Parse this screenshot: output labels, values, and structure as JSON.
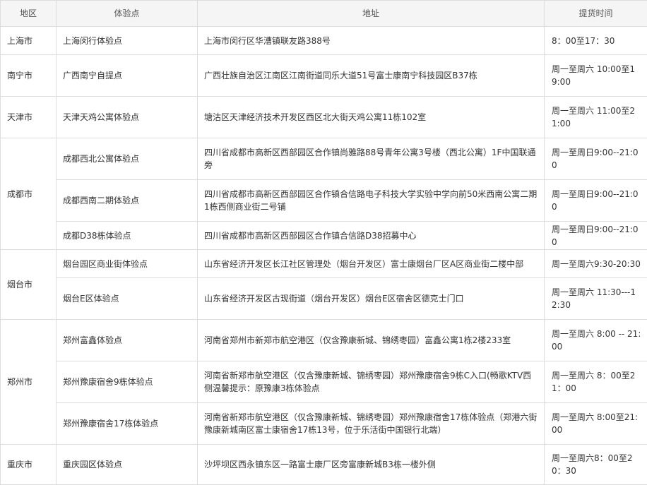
{
  "headers": [
    "地区",
    "体验点",
    "地址",
    "提货时间"
  ],
  "rows": [
    {
      "region": "上海市",
      "site": "上海闵行体验点",
      "address": "上海市闵行区华漕镇联友路388号",
      "hours": "8：00至17：30"
    },
    {
      "region": "南宁市",
      "site": "广西南宁自提点",
      "address": "广西壮族自治区江南区江南街道同乐大道51号富士康南宁科技园区B37栋",
      "hours": "周一至周六 10:00至19:00"
    },
    {
      "region": "天津市",
      "site": "天津天鸡公寓体验点",
      "address": "塘沽区天津经济技术开发区西区北大街天鸡公寓11栋102室",
      "hours": "周一至周六 11:00至21:00"
    },
    {
      "region": "成都市",
      "site": "成都西北公寓体验点",
      "address": "四川省成都市高新区西部园区合作镇尚雅路88号青年公寓3号楼（西北公寓）1F中国联通旁",
      "hours": "周一至周日9:00--21:00"
    },
    {
      "region": "",
      "site": "成都西南二期体验点",
      "address": "四川省成都市高新区西部园区合作镇合信路电子科技大学实验中学向前50米西南公寓二期1栋西侧商业街二号铺",
      "hours": "周一至周日9:00--21:00"
    },
    {
      "region": "",
      "site": "成都D38栋体验点",
      "address": "四川省成都市高新区西部园区合作镇合信路D38招募中心",
      "hours": "周一至周日9:00--21:00"
    },
    {
      "region": "烟台市",
      "site": "烟台园区商业街体验点",
      "address": "山东省经济开发区长江社区管理处（烟台开发区）富士康烟台厂区A区商业街二楼中部",
      "hours": "周一至周六9:30-20:30"
    },
    {
      "region": "",
      "site": "烟台E区体验点",
      "address": "山东省经济开发区古现街道（烟台开发区）烟台E区宿舍区德克士门口",
      "hours": "周一至周六 11:30---12:30"
    },
    {
      "region": "郑州市",
      "site": "郑州富鑫体验点",
      "address": "河南省郑州市新郑市航空港区（仅含豫康新城、锦绣枣园）富鑫公寓1栋2楼233室",
      "hours": "周一至周六 8:00 -- 21:00"
    },
    {
      "region": "",
      "site": "郑州豫康宿舍9栋体验点",
      "address": "河南省新郑市航空港区（仅含豫康新城、锦绣枣园）郑州豫康宿舍9栋C入口(畅歌KTV西侧温馨提示：原豫康3栋体验点",
      "hours": "周一至周六 8：00至21：00"
    },
    {
      "region": "",
      "site": "郑州豫康宿舍17栋体验点",
      "address": "河南省新郑市航空港区（仅含豫康新城、锦绣枣园）郑州豫康宿舍17栋体验点（郑港六街豫康新城南区富士康宿舍17栋13号，位于乐活街中国银行北端）",
      "hours": "周一至周六 8:00至21:00"
    },
    {
      "region": "重庆市",
      "site": "重庆园区体验点",
      "address": "沙坪坝区西永镇东区一路富士康厂区旁富康新城B3栋一楼外侧",
      "hours": "周一至周六8：00至20：30"
    }
  ]
}
